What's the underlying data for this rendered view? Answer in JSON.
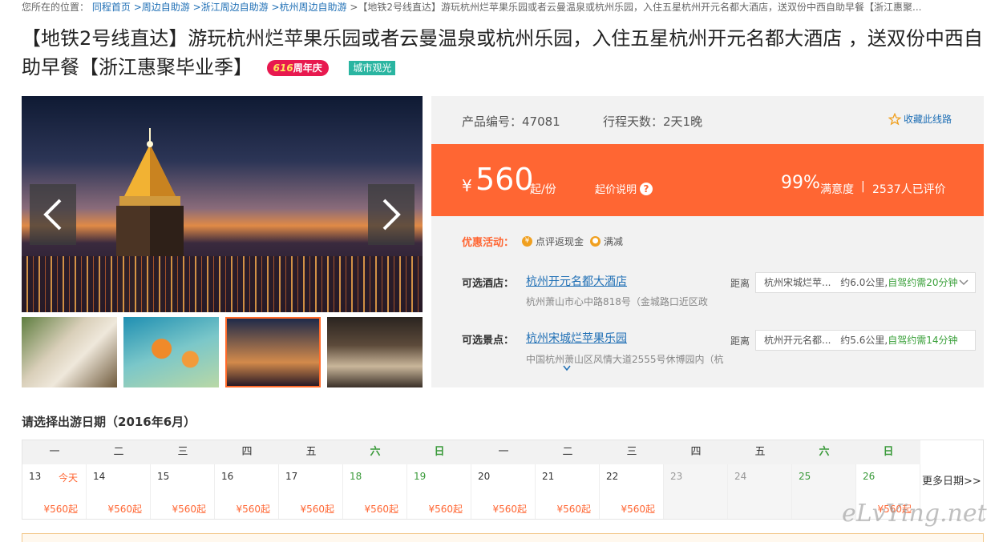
{
  "breadcrumb": {
    "prefix": "您所在的位置：",
    "links": [
      "同程首页",
      ">周边自助游",
      ">浙江周边自助游",
      ">杭州周边自助游"
    ],
    "current": " >【地铁2号线直达】游玩杭州烂苹果乐园或者云曼温泉或杭州乐园，入住五星杭州开元名都大酒店，送双份中西自助早餐【浙江惠聚..."
  },
  "title": "【地铁2号线直达】游玩杭州烂苹果乐园或者云曼温泉或杭州乐园，入住五星杭州开元名都大酒店 ，送双份中西自助早餐【浙江惠聚毕业季】",
  "badges": {
    "anniv_num": "616",
    "anniv_text": "周年庆",
    "category": "城市观光"
  },
  "product": {
    "id_label": "产品编号：47081",
    "days_label": "行程天数：2天1晚",
    "favorite": "收藏此线路"
  },
  "price": {
    "currency": "¥",
    "amount": "560",
    "unit": "起/份",
    "explain": "起价说明",
    "satisfaction": "99%",
    "satisfaction_label": "满意度",
    "divider": "|",
    "reviews": "2537人已评价"
  },
  "promo": {
    "label": "优惠活动：",
    "items": [
      "点评返现金",
      "满减"
    ]
  },
  "hotel": {
    "label": "可选酒店：",
    "name": "杭州开元名都大酒店",
    "address": "杭州萧山市心中路818号（金城路口近区政",
    "dist_label": "距离",
    "dist_target": "杭州宋城烂苹...",
    "dist_km": "约6.0公里,",
    "dist_drive": "自驾约需20分钟"
  },
  "spot": {
    "label": "可选景点：",
    "name": "杭州宋城烂苹果乐园",
    "address": "中国杭州萧山区风情大道2555号休博园内（杭",
    "dist_label": "距离",
    "dist_target": "杭州开元名都...",
    "dist_km": "约5.6公里,",
    "dist_drive": "自驾约需14分钟"
  },
  "calendar": {
    "title": "请选择出游日期（2016年6月）",
    "weekdays": [
      "一",
      "二",
      "三",
      "四",
      "五",
      "六",
      "日",
      "一",
      "二",
      "三",
      "四",
      "五",
      "六",
      "日"
    ],
    "days": [
      {
        "n": "13",
        "today": "今天",
        "price": "¥560起"
      },
      {
        "n": "14",
        "price": "¥560起"
      },
      {
        "n": "15",
        "price": "¥560起"
      },
      {
        "n": "16",
        "price": "¥560起"
      },
      {
        "n": "17",
        "price": "¥560起"
      },
      {
        "n": "18",
        "price": "¥560起"
      },
      {
        "n": "19",
        "price": "¥560起"
      },
      {
        "n": "20",
        "price": "¥560起"
      },
      {
        "n": "21",
        "price": "¥560起"
      },
      {
        "n": "22",
        "price": "¥560起"
      },
      {
        "n": "23"
      },
      {
        "n": "24"
      },
      {
        "n": "25"
      },
      {
        "n": "26",
        "price": "¥560起"
      }
    ],
    "more": "更多日期>>"
  },
  "watermark": "eLvYing.net",
  "colors": {
    "accent": "#ff6633",
    "link": "#1f6fb5",
    "weekend": "#3a9a3a",
    "tag": "#2ab5a1"
  }
}
